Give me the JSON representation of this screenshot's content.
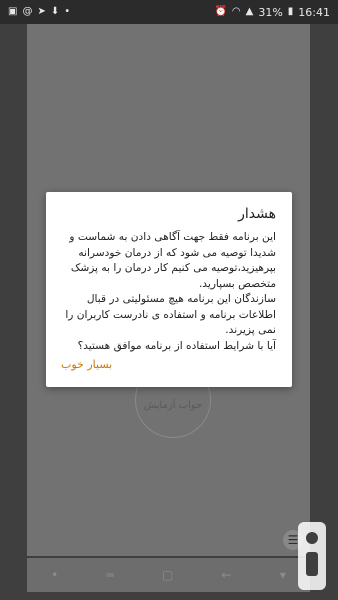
{
  "status_bar": {
    "time": "16:41",
    "battery": "31%"
  },
  "background": {
    "circle_label": "جواب آزمایش"
  },
  "dialog": {
    "title": "هشدار",
    "body": "این برنامه فقط جهت آگاهی دادن به شماست و شدیدا توصیه می شود که از درمان خودسرانه بپرهیزید،توصیه می کنیم کار درمان را به پزشک متخصص بسپارید.\nسازندگان این برنامه هیچ مسئولیتی در قبال اطلاعات برنامه و استفاده ی نادرست کاربران را نمی پزیرند.\nآیا با شرایط استفاده از برنامه موافق هستید؟",
    "button_label": "بسیار خوب"
  },
  "colors": {
    "accent": "#c8790a",
    "overlay": "#727272"
  }
}
